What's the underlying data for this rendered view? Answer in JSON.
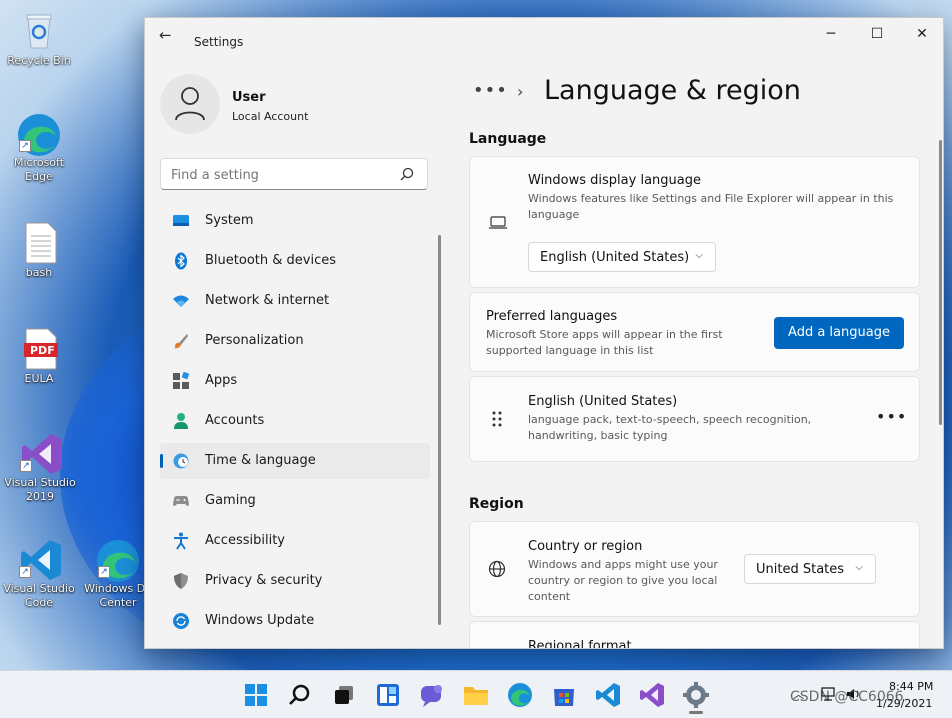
{
  "desktop": {
    "icons": [
      {
        "label": "Recycle Bin"
      },
      {
        "label": "Microsoft Edge"
      },
      {
        "label": "bash"
      },
      {
        "label": "EULA",
        "badge": "PDF"
      },
      {
        "label": "Visual Studio 2019"
      },
      {
        "label": "Visual Studio Code"
      },
      {
        "label": "Windows De Center"
      }
    ]
  },
  "window": {
    "title": "Settings",
    "controls": {
      "minimize": "─",
      "maximize": "☐",
      "close": "✕"
    },
    "back": "←"
  },
  "profile": {
    "name": "User",
    "account": "Local Account"
  },
  "search": {
    "placeholder": "Find a setting"
  },
  "nav": {
    "items": [
      {
        "label": "System",
        "icon": "system-icon",
        "color": "#0078d4"
      },
      {
        "label": "Bluetooth & devices",
        "icon": "bluetooth-icon",
        "color": "#0078d4"
      },
      {
        "label": "Network & internet",
        "icon": "wifi-icon",
        "color": "#0078d4"
      },
      {
        "label": "Personalization",
        "icon": "brush-icon",
        "color": "#e07a30"
      },
      {
        "label": "Apps",
        "icon": "apps-icon",
        "color": "#555555"
      },
      {
        "label": "Accounts",
        "icon": "accounts-icon",
        "color": "#1aa37a"
      },
      {
        "label": "Time & language",
        "icon": "globe-clock-icon",
        "color": "#0078d4",
        "active": true
      },
      {
        "label": "Gaming",
        "icon": "gamepad-icon",
        "color": "#777777"
      },
      {
        "label": "Accessibility",
        "icon": "accessibility-icon",
        "color": "#0078d4"
      },
      {
        "label": "Privacy & security",
        "icon": "shield-icon",
        "color": "#777777"
      },
      {
        "label": "Windows Update",
        "icon": "update-icon",
        "color": "#0078d4"
      }
    ]
  },
  "main": {
    "breadcrumb_more": "•••",
    "breadcrumb_sep": "›",
    "title": "Language & region",
    "language_section": "Language",
    "display_language": {
      "title": "Windows display language",
      "desc": "Windows features like Settings and File Explorer will appear in this language",
      "value": "English (United States)"
    },
    "preferred": {
      "title": "Preferred languages",
      "desc": "Microsoft Store apps will appear in the first supported language in this list",
      "button": "Add a language"
    },
    "english_entry": {
      "title": "English (United States)",
      "desc": "language pack, text-to-speech, speech recognition, handwriting, basic typing",
      "more": "•••"
    },
    "region_section": "Region",
    "country": {
      "title": "Country or region",
      "desc": "Windows and apps might use your country or region to give you local content",
      "value": "United States"
    },
    "regional_format": {
      "title": "Regional format"
    }
  },
  "taskbar": {
    "clock_time": "8:44 PM",
    "clock_date": "1/29/2021",
    "tray_chevron": "︿",
    "watermark": "CSDN @CC6066"
  },
  "colors": {
    "accent": "#0067c0",
    "window_bg": "#f3f3f3",
    "card_bg": "#fbfbfb"
  }
}
